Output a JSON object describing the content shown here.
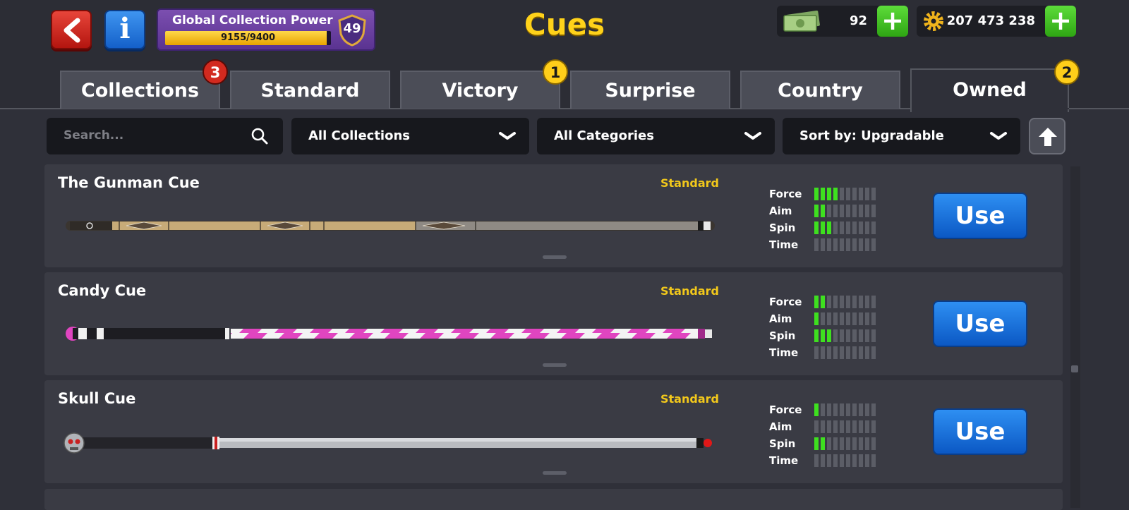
{
  "header": {
    "title": "Cues",
    "global_collection_power": {
      "label": "Global Collection Power",
      "progress_text": "9155/9400",
      "current": 9155,
      "max": 9400,
      "level": "49"
    },
    "cash": {
      "value": "92",
      "plus": "+"
    },
    "coins": {
      "value": "207 473 238",
      "plus": "+"
    }
  },
  "tabs": [
    {
      "label": "Collections",
      "badge": "3",
      "active": false
    },
    {
      "label": "Standard",
      "badge": "",
      "active": false
    },
    {
      "label": "Victory",
      "badge": "1",
      "active": false
    },
    {
      "label": "Surprise",
      "badge": "",
      "active": false
    },
    {
      "label": "Country",
      "badge": "",
      "active": false
    },
    {
      "label": "Owned",
      "badge": "2",
      "active": true
    }
  ],
  "filters": {
    "search_placeholder": "Search...",
    "collections": "All Collections",
    "categories": "All Categories",
    "sort": "Sort by: Upgradable"
  },
  "stat_labels": [
    "Force",
    "Aim",
    "Spin",
    "Time"
  ],
  "stat_max": 10,
  "cues": [
    {
      "name": "The Gunman Cue",
      "category": "Standard",
      "stats": {
        "force": 4,
        "aim": 2,
        "spin": 3,
        "time": 0
      },
      "action": "Use",
      "style": "gunman"
    },
    {
      "name": "Candy Cue",
      "category": "Standard",
      "stats": {
        "force": 2,
        "aim": 1,
        "spin": 3,
        "time": 0
      },
      "action": "Use",
      "style": "candy"
    },
    {
      "name": "Skull Cue",
      "category": "Standard",
      "stats": {
        "force": 1,
        "aim": 0,
        "spin": 2,
        "time": 0
      },
      "action": "Use",
      "style": "skull"
    }
  ],
  "colors": {
    "title": "#ffd21a",
    "category": "#f2c81b",
    "stat_on": "#3ee01f",
    "use_button": "#1a72dc",
    "back_button": "#d22a1f",
    "badge_red": "#d22a1f",
    "badge_yellow": "#ffce1a"
  }
}
